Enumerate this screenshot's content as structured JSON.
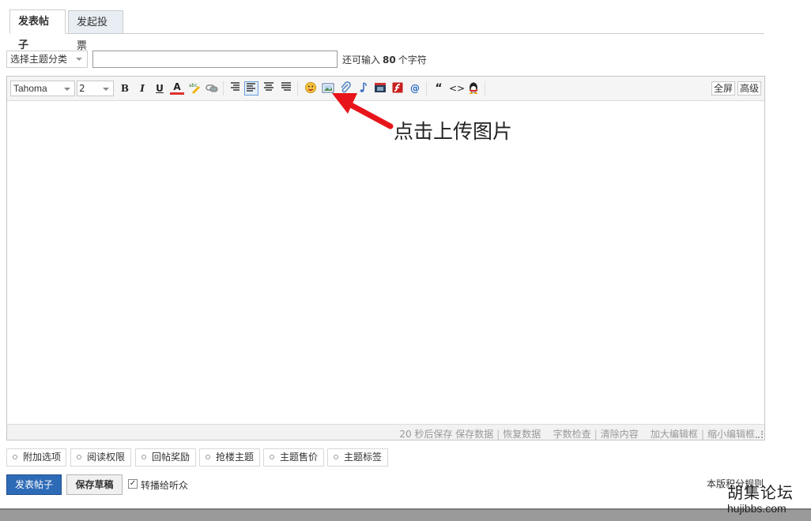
{
  "tabs": [
    {
      "label": "发表帖子",
      "active": true
    },
    {
      "label": "发起投票",
      "active": false
    }
  ],
  "topbar": {
    "category_selected": "选择主题分类",
    "subject_value": "",
    "remain_prefix": "还可输入",
    "remain_count": "80",
    "remain_suffix": "个字符"
  },
  "toolbar": {
    "font_family": "Tahoma",
    "font_size": "2",
    "bold": "B",
    "italic": "I",
    "underline": "U",
    "font_color": "A",
    "quote": "“",
    "code": "<>",
    "fullscreen": "全屏",
    "advanced": "高级"
  },
  "annotation": {
    "text": "点击上传图片",
    "arrow_color": "#e8141b"
  },
  "statusbar": {
    "autosave": "20 秒后保存",
    "save_data": "保存数据",
    "restore_data": "恢复数据",
    "word_check": "字数检查",
    "clear_content": "清除内容",
    "enlarge": "加大编辑框",
    "shrink": "缩小编辑框"
  },
  "options": [
    "附加选项",
    "阅读权限",
    "回帖奖励",
    "抢楼主题",
    "主题售价",
    "主题标签"
  ],
  "actions": {
    "submit": "发表帖子",
    "save_draft": "保存草稿",
    "broadcast_label": "转播给听众",
    "broadcast_checked": true,
    "rules_link": "本版积分规则"
  },
  "watermark": {
    "title": "胡集论坛",
    "url": "hujibbs.com"
  },
  "colors": {
    "primary_button": "#2e6bb7",
    "tab_inactive": "#e8eef4",
    "annotation_arrow": "#e8141b"
  }
}
